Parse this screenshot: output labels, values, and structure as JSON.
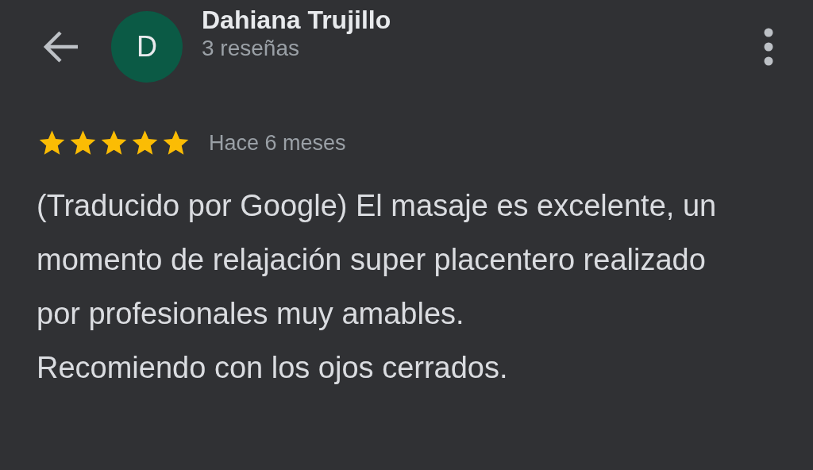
{
  "header": {
    "avatar_letter": "D",
    "name": "Dahiana Trujillo",
    "subtitle": "3 reseñas"
  },
  "review": {
    "stars": 5,
    "time": "Hace 6 meses",
    "paragraphs": [
      "(Traducido por Google) El masaje es excelente, un momento de relajación super placentero realizado por profesionales muy amables.",
      "Recomiendo con los ojos cerrados."
    ]
  }
}
